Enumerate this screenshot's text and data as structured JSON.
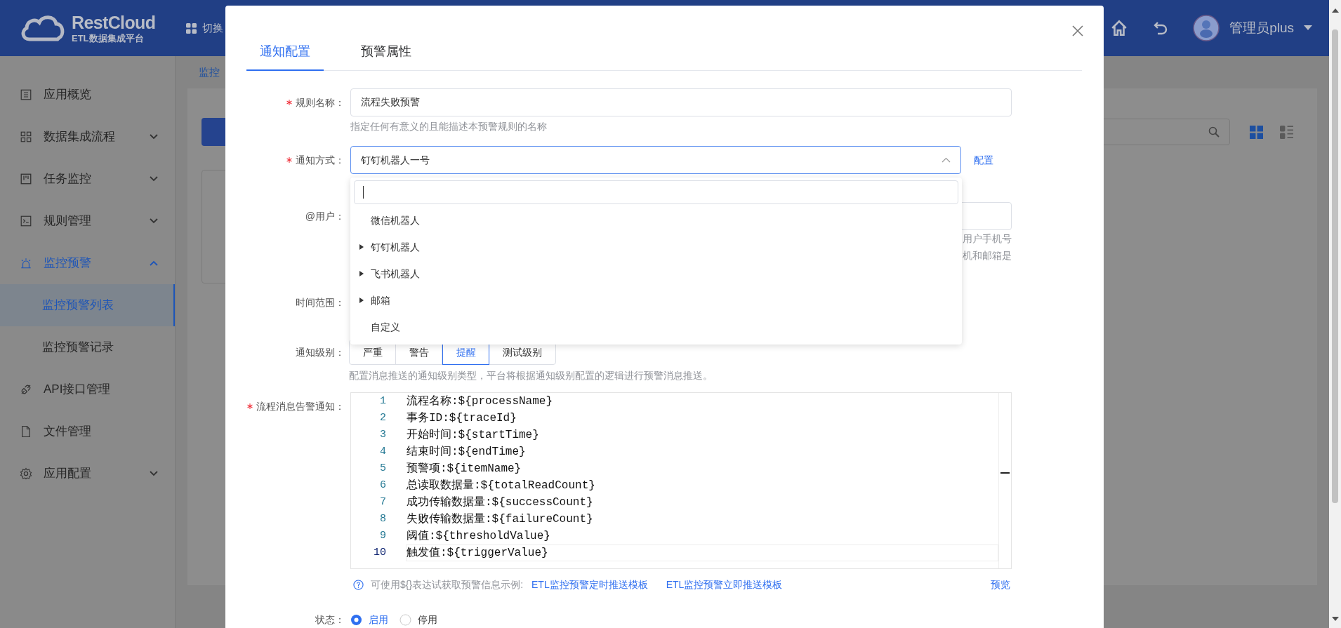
{
  "header": {
    "logo_title": "RestCloud",
    "logo_subtitle": "ETL数据集成平台",
    "switch_label": "切换",
    "user_name": "管理员plus"
  },
  "sidebar": {
    "items": [
      {
        "label": "应用概览"
      },
      {
        "label": "数据集成流程",
        "expanded": false
      },
      {
        "label": "任务监控",
        "expanded": false
      },
      {
        "label": "规则管理",
        "expanded": false
      },
      {
        "label": "监控预警",
        "expanded": true,
        "children": [
          {
            "label": "监控预警列表",
            "selected": true
          },
          {
            "label": "监控预警记录",
            "selected": false
          }
        ]
      },
      {
        "label": "API接口管理"
      },
      {
        "label": "文件管理"
      },
      {
        "label": "应用配置",
        "expanded": false
      }
    ]
  },
  "breadcrumb": "监控",
  "view_toggle": [
    {
      "selected": true
    },
    {
      "selected": false
    }
  ],
  "modal": {
    "tabs": [
      {
        "label": "通知配置",
        "selected": true
      },
      {
        "label": "预警属性",
        "selected": false
      }
    ],
    "rule_name": {
      "label": "规则名称：",
      "required": true,
      "value": "流程失败预警",
      "hint": "指定任何有意义的且能描述本预警规则的名称"
    },
    "notify_method": {
      "label": "通知方式：",
      "required": true,
      "value": "钉钉机器人一号",
      "link": "配置",
      "dropdown": {
        "options": [
          {
            "label": "微信机器人",
            "expandable": false
          },
          {
            "label": "钉钉机器人",
            "expandable": true
          },
          {
            "label": "飞书机器人",
            "expandable": true
          },
          {
            "label": "邮箱",
            "expandable": true
          },
          {
            "label": "自定义",
            "expandable": false
          }
        ]
      }
    },
    "at_user": {
      "label": "@用户：",
      "hint_lines": [
        "用户手机号",
        "机和邮箱是"
      ]
    },
    "time_range": {
      "label": "时间范围："
    },
    "notify_level": {
      "label": "通知级别：",
      "options": [
        {
          "label": "严重",
          "selected": false
        },
        {
          "label": "警告",
          "selected": false
        },
        {
          "label": "提醒",
          "selected": true
        },
        {
          "label": "测试级别",
          "selected": false
        }
      ],
      "hint": "配置消息推送的通知级别类型，平台将根据通知级别配置的逻辑进行预警消息推送。"
    },
    "template": {
      "label": "流程消息告警通知：",
      "required": true,
      "lines": [
        {
          "number": "1",
          "code": "流程名称:${processName}",
          "active": false
        },
        {
          "number": "2",
          "code": "事务ID:${traceId}",
          "active": false
        },
        {
          "number": "3",
          "code": "开始时间:${startTime}",
          "active": false
        },
        {
          "number": "4",
          "code": "结束时间:${endTime}",
          "active": false
        },
        {
          "number": "5",
          "code": "预警项:${itemName}",
          "active": false
        },
        {
          "number": "6",
          "code": "总读取数据量:${totalReadCount}",
          "active": false
        },
        {
          "number": "7",
          "code": "成功传输数据量:${successCount}",
          "active": false
        },
        {
          "number": "8",
          "code": "失败传输数据量:${failureCount}",
          "active": false
        },
        {
          "number": "9",
          "code": "阈值:${thresholdValue}",
          "active": false
        },
        {
          "number": "10",
          "code": "触发值:${triggerValue}",
          "active": true
        }
      ]
    },
    "help": {
      "text": "可使用${}表达试获取预警信息示例:",
      "links": [
        "ETL监控预警定时推送模板",
        "ETL监控预警立即推送模板"
      ],
      "preview": "预览"
    },
    "status": {
      "label": "状态：",
      "options": [
        {
          "label": "启用",
          "selected": true
        },
        {
          "label": "停用",
          "selected": false
        }
      ]
    }
  }
}
